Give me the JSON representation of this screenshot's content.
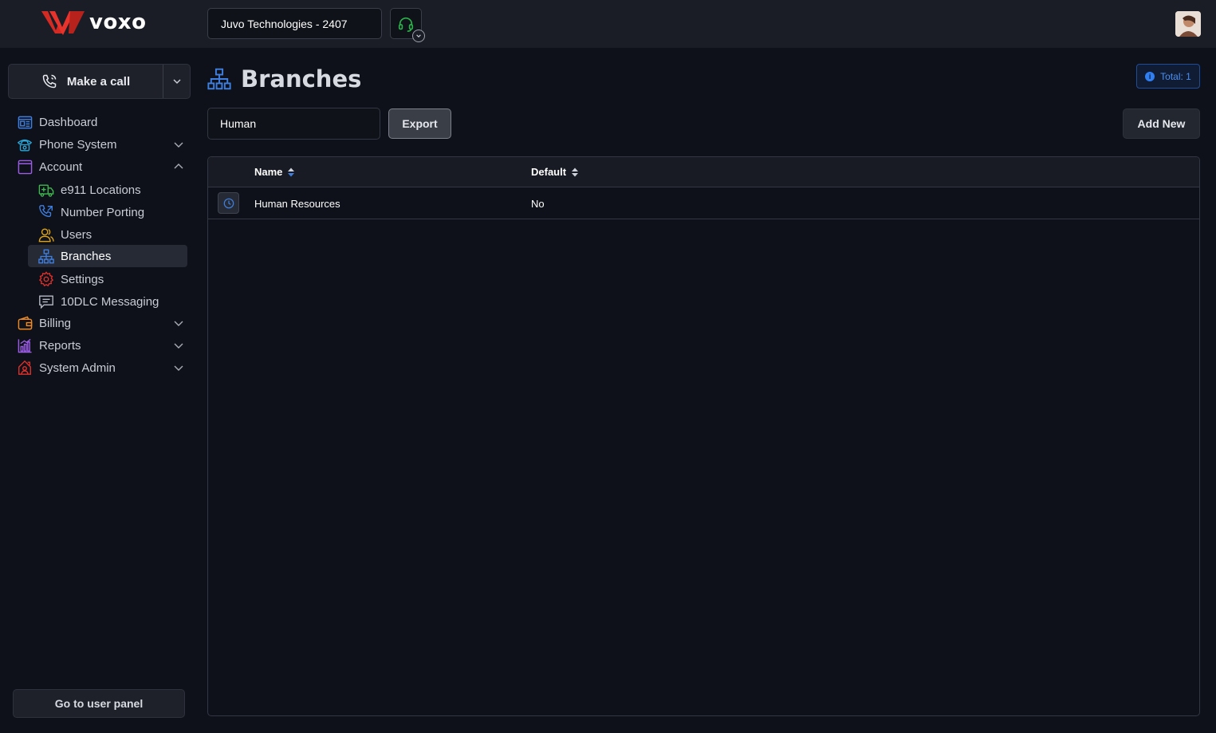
{
  "header": {
    "logo_text": "voxo",
    "organization": "Juvo Technologies - 2407",
    "headset_icon": "headset-icon",
    "avatar": "user-avatar"
  },
  "sidebar": {
    "make_call_label": "Make a call",
    "items": [
      {
        "label": "Dashboard",
        "icon": "dashboard-icon"
      },
      {
        "label": "Phone System",
        "icon": "phone-icon"
      },
      {
        "label": "Account",
        "icon": "window-icon"
      },
      {
        "label": "e911 Locations",
        "icon": "ambulance-icon"
      },
      {
        "label": "Number Porting",
        "icon": "number-porting-icon"
      },
      {
        "label": "Users",
        "icon": "users-icon"
      },
      {
        "label": "Branches",
        "icon": "branches-icon"
      },
      {
        "label": "Settings",
        "icon": "gear-icon"
      },
      {
        "label": "10DLC Messaging",
        "icon": "message-icon"
      },
      {
        "label": "Billing",
        "icon": "wallet-icon"
      },
      {
        "label": "Reports",
        "icon": "chart-icon"
      },
      {
        "label": "System Admin",
        "icon": "admin-icon"
      }
    ],
    "user_panel_label": "Go to user panel"
  },
  "main": {
    "title": "Branches",
    "total_badge": "Total: 1",
    "search_value": "Human",
    "export_label": "Export",
    "add_new_label": "Add New",
    "table": {
      "columns": [
        "Name",
        "Default"
      ],
      "rows": [
        {
          "name": "Human Resources",
          "default": "No"
        }
      ]
    }
  },
  "colors": {
    "accent_blue": "#2f7ff2",
    "brand_red": "#e0302a",
    "background": "#0e1119"
  }
}
